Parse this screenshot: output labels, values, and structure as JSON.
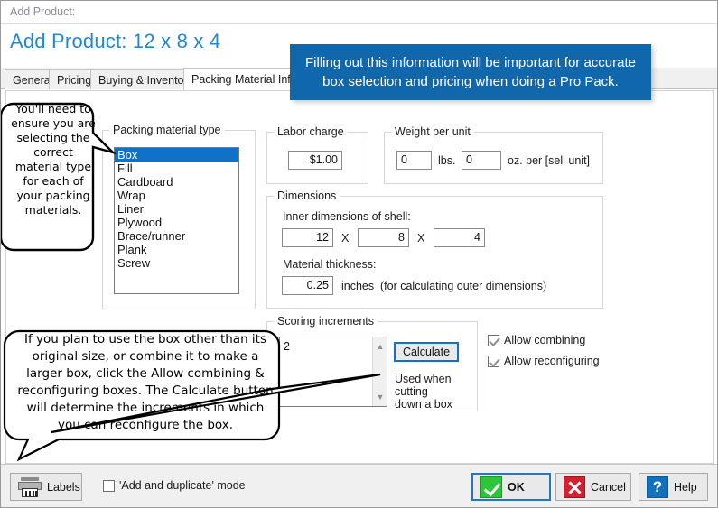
{
  "window": {
    "title": "Add Product:"
  },
  "header": {
    "title": "Add Product: 12 x 8 x 4"
  },
  "tabs": [
    {
      "label": "General",
      "active": false
    },
    {
      "label": "Pricing",
      "active": false
    },
    {
      "label": "Buying & Inventory",
      "active": false
    },
    {
      "label": "Packing Material Info",
      "active": true
    }
  ],
  "blue_callout": {
    "text": "Filling out this information will be important for accurate box selection and pricing when doing a Pro Pack.",
    "color": "#1167ac"
  },
  "callout_material": {
    "text": "You'll need to ensure you are selecting the correct material type for each of your packing materials."
  },
  "callout_bottom": {
    "text": "If you plan to use the box other than its original size, or combine it to make a larger box, click the Allow combining & reconfiguring boxes. The Calculate button will determine the increments in which you can reconfigure the box."
  },
  "packing_material": {
    "legend": "Packing material type",
    "options": [
      "Box",
      "Fill",
      "Cardboard",
      "Wrap",
      "Liner",
      "Plywood",
      "Brace/runner",
      "Plank",
      "Screw"
    ],
    "selected": "Box",
    "selected_color": "#0f72c8"
  },
  "labor_charge": {
    "legend": "Labor charge",
    "value": "$1.00"
  },
  "weight_per_unit": {
    "legend": "Weight per unit",
    "lbs_value": "0",
    "lbs_label": "lbs.",
    "oz_value": "0",
    "oz_label": "oz. per [sell unit]"
  },
  "dimensions": {
    "legend": "Dimensions",
    "inner_label": "Inner dimensions of shell:",
    "length": "12",
    "width": "8",
    "height": "4",
    "separator": "X",
    "thickness_label": "Material thickness:",
    "thickness": "0.25",
    "thickness_units": "inches",
    "thickness_note": "(for calculating outer dimensions)"
  },
  "scoring": {
    "legend": "Scoring increments",
    "items": [
      "2"
    ],
    "calculate_label": "Calculate",
    "hint": "Used when cutting down a box"
  },
  "options": {
    "allow_combining": {
      "label": "Allow combining",
      "checked": true
    },
    "allow_reconfiguring": {
      "label": "Allow reconfiguring",
      "checked": true
    }
  },
  "footer": {
    "labels_button": "Labels",
    "add_duplicate": {
      "label": "'Add and duplicate' mode",
      "checked": false
    },
    "ok": "OK",
    "cancel": "Cancel",
    "help": "Help"
  }
}
